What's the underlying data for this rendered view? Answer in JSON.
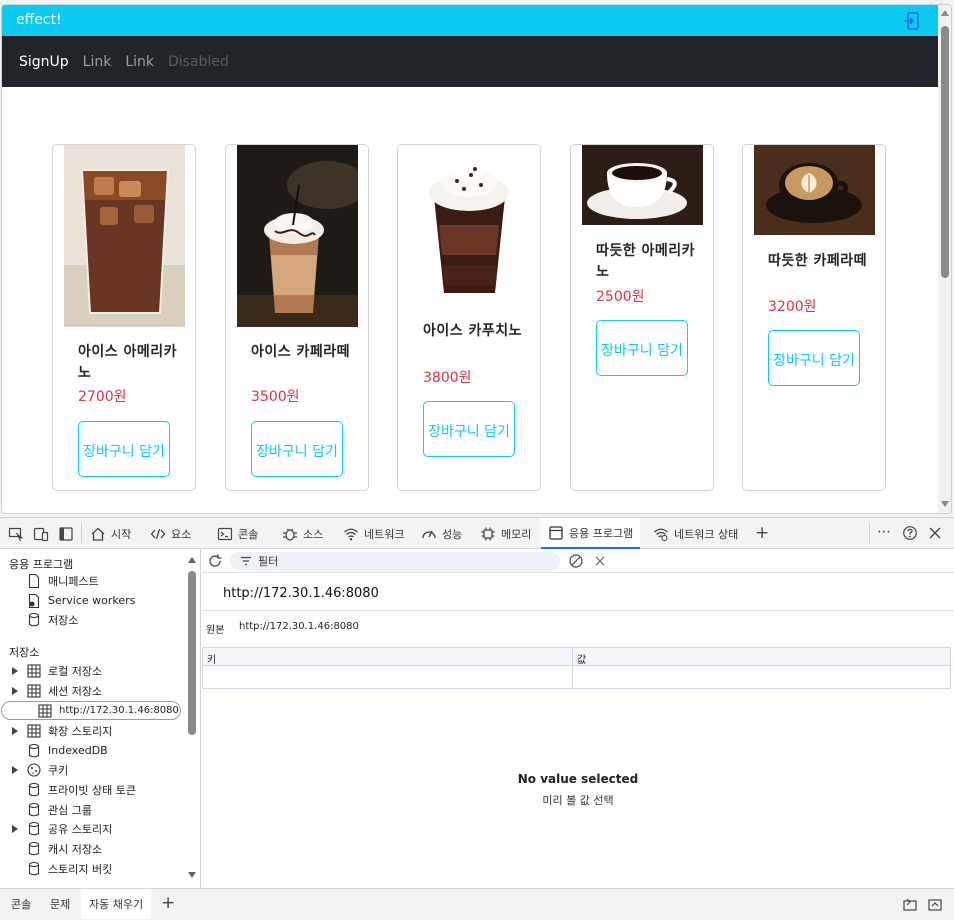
{
  "page": {
    "title": "effect!",
    "nav": {
      "brand": "SignUp",
      "link1": "Link",
      "link2": "Link",
      "disabled": "Disabled"
    },
    "products": [
      {
        "name": "아이스 아메리카노",
        "price": "2700원",
        "button": "장바구니 담기",
        "image": "iced-americano"
      },
      {
        "name": "아이스 카페라떼",
        "price": "3500원",
        "button": "장바구니 담기",
        "image": "iced-latte"
      },
      {
        "name": "아이스 카푸치노",
        "price": "3800원",
        "button": "장바구니 담기",
        "image": "iced-cappuccino"
      },
      {
        "name": "따듯한 아메리카노",
        "price": "2500원",
        "button": "장바구니 담기",
        "image": "hot-americano"
      },
      {
        "name": "따듯한 카페라떼",
        "price": "3200원",
        "button": "장바구니 담기",
        "image": "hot-latte"
      }
    ],
    "colors": {
      "topbar": "#0dcaf0",
      "navbar": "#212529",
      "price": "#dc3545",
      "button": "#0dcaf0"
    }
  },
  "devtools": {
    "tabs": {
      "start": "시작",
      "elements": "요소",
      "console": "콘솔",
      "sources": "소스",
      "network": "네트워크",
      "performance": "성능",
      "memory": "메모리",
      "application": "응용 프로그램",
      "network_conditions": "네트워크 상태"
    },
    "sidebar": {
      "app_header": "응용 프로그램",
      "manifest": "매니페스트",
      "service_workers": "Service workers",
      "storage": "저장소",
      "storage_header": "저장소",
      "local_storage": "로컬 저장소",
      "session_storage": "세션 저장소",
      "session_origin": "http://172.30.1.46:8080",
      "extension_storage": "확장 스토리지",
      "indexeddb": "IndexedDB",
      "cookies": "쿠키",
      "private_state_tokens": "프라이빗 상태 토큰",
      "interest_groups": "관심 그룹",
      "shared_storage": "공유 스토리지",
      "cache_storage": "캐시 저장소",
      "storage_buckets": "스토리지 버킷"
    },
    "main": {
      "filter_placeholder": "필터",
      "origin_title": "http://172.30.1.46:8080",
      "origin_label": "원본",
      "origin_value": "http://172.30.1.46:8080",
      "col_key": "키",
      "col_value": "값",
      "empty_title": "No value selected",
      "empty_sub": "미리 볼 값 선택"
    },
    "drawer": {
      "console": "콘솔",
      "issues": "문제",
      "autofill": "자동 채우기"
    }
  }
}
